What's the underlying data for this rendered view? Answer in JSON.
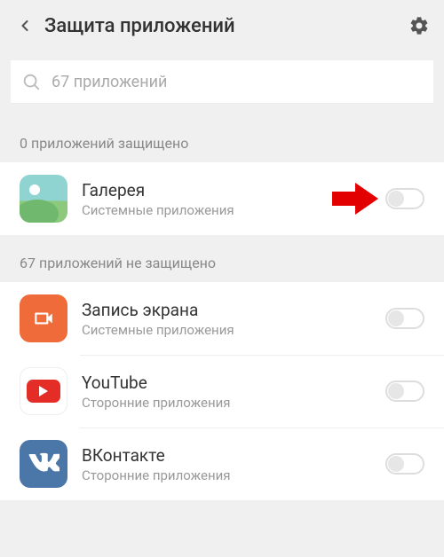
{
  "header": {
    "title": "Защита приложений"
  },
  "search": {
    "placeholder": "67 приложений"
  },
  "sections": {
    "protected": {
      "header": "0 приложений защищено"
    },
    "unprotected": {
      "header": "67 приложений не защищено"
    }
  },
  "apps": {
    "gallery": {
      "name": "Галерея",
      "sub": "Системные приложения",
      "toggled": false
    },
    "recorder": {
      "name": "Запись экрана",
      "sub": "Системные приложения",
      "toggled": false
    },
    "youtube": {
      "name": "YouTube",
      "sub": "Сторонние приложения",
      "toggled": false
    },
    "vk": {
      "name": "ВКонтакте",
      "sub": "Сторонние приложения",
      "toggled": false
    }
  }
}
